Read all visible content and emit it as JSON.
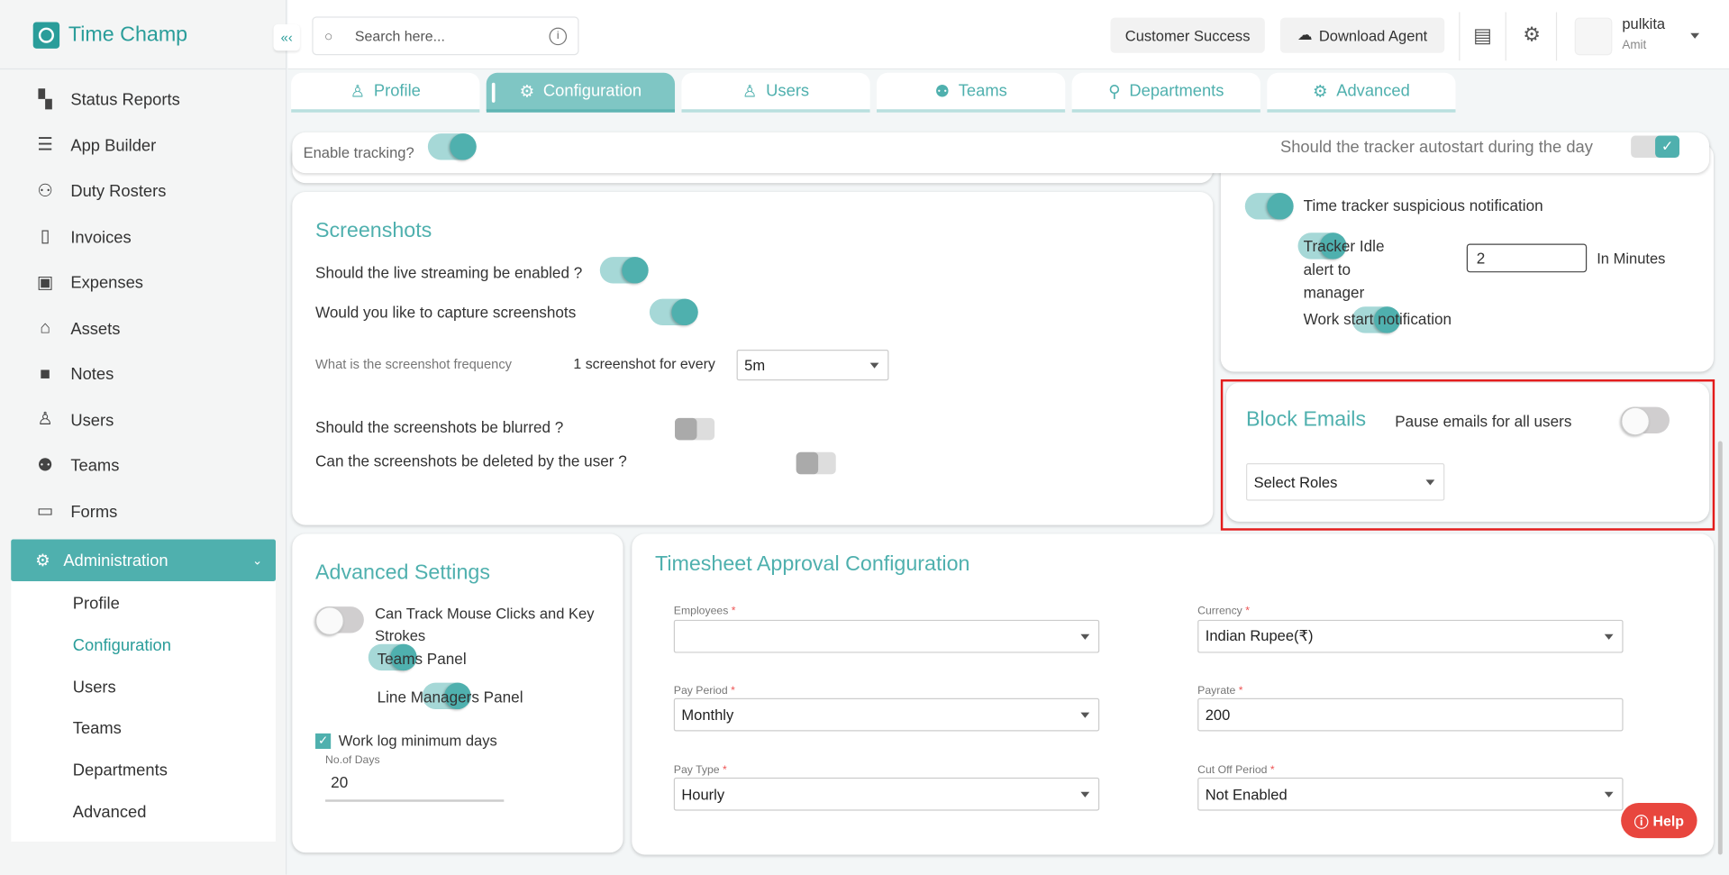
{
  "app": {
    "name": "Time Champ"
  },
  "sidebar": {
    "items": [
      {
        "label": "Status Reports",
        "icon": "dashboard-icon"
      },
      {
        "label": "App Builder",
        "icon": "receipt-icon"
      },
      {
        "label": "Duty Rosters",
        "icon": "user-plus-icon"
      },
      {
        "label": "Invoices",
        "icon": "invoice-icon"
      },
      {
        "label": "Expenses",
        "icon": "wallet-icon"
      },
      {
        "label": "Assets",
        "icon": "bank-icon"
      },
      {
        "label": "Notes",
        "icon": "note-icon"
      },
      {
        "label": "Users",
        "icon": "user-icon"
      },
      {
        "label": "Teams",
        "icon": "team-icon"
      },
      {
        "label": "Forms",
        "icon": "file-icon"
      }
    ],
    "admin": {
      "label": "Administration",
      "sub": [
        "Profile",
        "Configuration",
        "Users",
        "Teams",
        "Departments",
        "Advanced"
      ]
    }
  },
  "header": {
    "search_placeholder": "Search here...",
    "customer_success": "Customer Success",
    "download_agent": "Download Agent",
    "user_name": "pulkita",
    "user_role": "Amit"
  },
  "tabs": [
    "Profile",
    "Configuration",
    "Users",
    "Teams",
    "Departments",
    "Advanced"
  ],
  "tracking": {
    "enable_label": "Enable tracking?",
    "enable_on": true,
    "autostart_label": "Should the tracker autostart during the day",
    "autostart_checked": true
  },
  "screenshots": {
    "title": "Screenshots",
    "live_streaming": "Should the live streaming be enabled ?",
    "capture": "Would you like to capture screenshots",
    "frequency_label": "What is the screenshot frequency",
    "every_label": "1 screenshot for every",
    "frequency_value": "5m",
    "blurred": "Should the screenshots be blurred ?",
    "deleted": "Can the screenshots be deleted by the user ?"
  },
  "notifications": {
    "suspicious": "Time tracker suspicious notification",
    "idle_label": "Tracker Idle alert to manager",
    "idle_value": "2",
    "idle_unit": "In Minutes",
    "work_start": "Work start notification"
  },
  "block_emails": {
    "title": "Block Emails",
    "pause_label": "Pause emails for all users",
    "pause_on": false,
    "roles_placeholder": "Select Roles",
    "highlight_color": "#e31b1b"
  },
  "advanced": {
    "title": "Advanced Settings",
    "mouse": "Can Track Mouse Clicks and Key Strokes",
    "teams": "Teams Panel",
    "line_managers": "Line Managers Panel",
    "worklog": "Work log minimum days",
    "days_label": "No.of Days",
    "days_value": "20"
  },
  "timesheet": {
    "title": "Timesheet Approval Configuration",
    "employees_label": "Employees",
    "employees_value": "",
    "currency_label": "Currency",
    "currency_value": "Indian Rupee(₹)",
    "pay_period_label": "Pay Period",
    "pay_period_value": "Monthly",
    "payrate_label": "Payrate",
    "payrate_value": "200",
    "pay_type_label": "Pay Type",
    "pay_type_value": "Hourly",
    "cutoff_label": "Cut Off Period",
    "cutoff_value": "Not Enabled"
  },
  "help": {
    "label": "Help"
  }
}
